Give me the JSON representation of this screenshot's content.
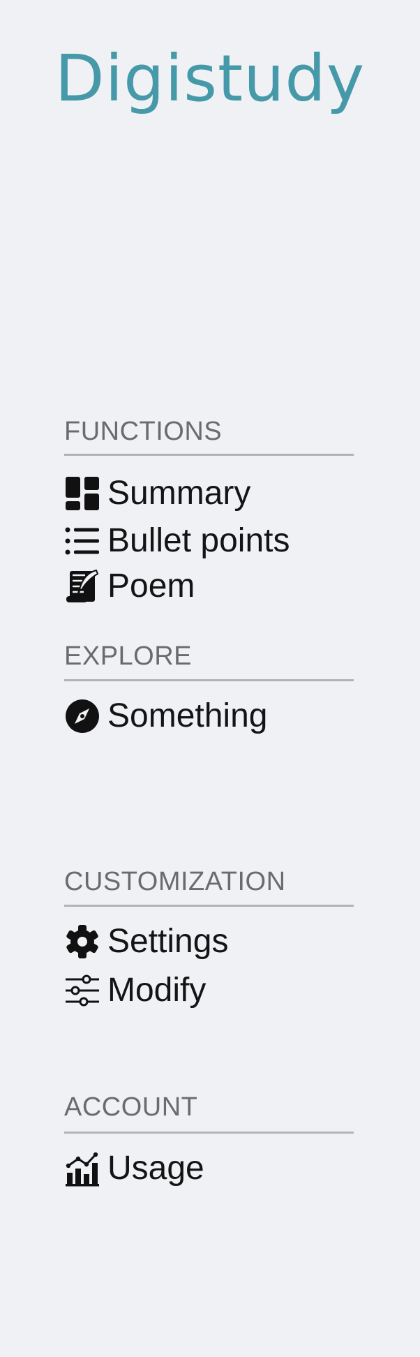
{
  "app": {
    "title": "Digistudy"
  },
  "colors": {
    "brand": "#4599a8",
    "background": "#f0f1f5",
    "section_title": "#6b6b6e",
    "divider": "#b3b3b6",
    "item_text": "#141414"
  },
  "sections": {
    "functions": {
      "title": "FUNCTIONS",
      "items": [
        {
          "label": "Summary",
          "icon": "dashboard-icon"
        },
        {
          "label": "Bullet points",
          "icon": "list-icon"
        },
        {
          "label": "Poem",
          "icon": "scroll-quill-icon"
        }
      ]
    },
    "explore": {
      "title": "EXPLORE",
      "items": [
        {
          "label": "Something",
          "icon": "compass-icon"
        }
      ]
    },
    "customization": {
      "title": "CUSTOMIZATION",
      "items": [
        {
          "label": "Settings",
          "icon": "gear-icon"
        },
        {
          "label": "Modify",
          "icon": "sliders-icon"
        }
      ]
    },
    "account": {
      "title": "ACCOUNT",
      "items": [
        {
          "label": "Usage",
          "icon": "chart-icon"
        }
      ]
    }
  }
}
